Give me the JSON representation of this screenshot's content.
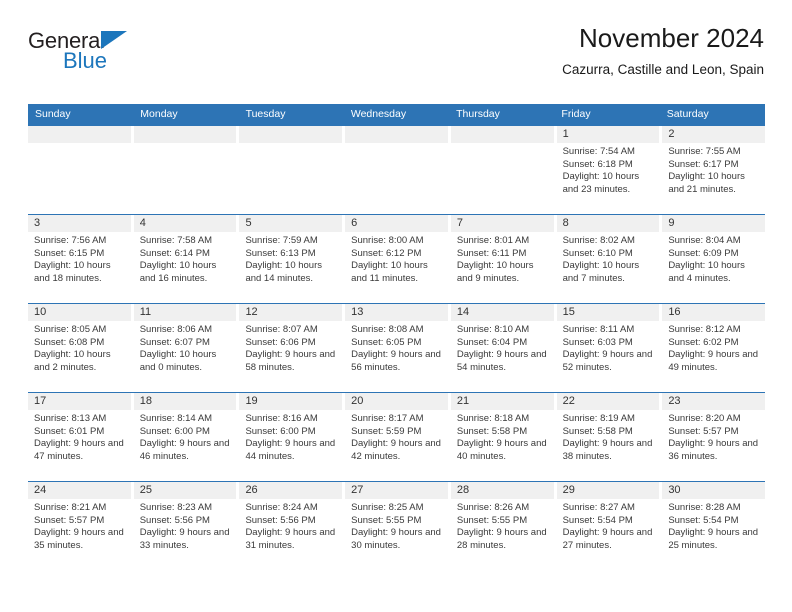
{
  "brand": {
    "name_top": "General",
    "name_bottom": "Blue",
    "accent_color": "#1c76bc"
  },
  "header": {
    "title": "November 2024",
    "subtitle": "Cazurra, Castille and Leon, Spain"
  },
  "calendar": {
    "header_color": "#2d74b5",
    "day_strip_color": "#f0f0f0",
    "weekdays": [
      "Sunday",
      "Monday",
      "Tuesday",
      "Wednesday",
      "Thursday",
      "Friday",
      "Saturday"
    ],
    "weeks": [
      [
        {
          "day": "",
          "blank": true
        },
        {
          "day": "",
          "blank": true
        },
        {
          "day": "",
          "blank": true
        },
        {
          "day": "",
          "blank": true
        },
        {
          "day": "",
          "blank": true
        },
        {
          "day": "1",
          "sunrise": "Sunrise: 7:54 AM",
          "sunset": "Sunset: 6:18 PM",
          "daylight": "Daylight: 10 hours and 23 minutes."
        },
        {
          "day": "2",
          "sunrise": "Sunrise: 7:55 AM",
          "sunset": "Sunset: 6:17 PM",
          "daylight": "Daylight: 10 hours and 21 minutes."
        }
      ],
      [
        {
          "day": "3",
          "sunrise": "Sunrise: 7:56 AM",
          "sunset": "Sunset: 6:15 PM",
          "daylight": "Daylight: 10 hours and 18 minutes."
        },
        {
          "day": "4",
          "sunrise": "Sunrise: 7:58 AM",
          "sunset": "Sunset: 6:14 PM",
          "daylight": "Daylight: 10 hours and 16 minutes."
        },
        {
          "day": "5",
          "sunrise": "Sunrise: 7:59 AM",
          "sunset": "Sunset: 6:13 PM",
          "daylight": "Daylight: 10 hours and 14 minutes."
        },
        {
          "day": "6",
          "sunrise": "Sunrise: 8:00 AM",
          "sunset": "Sunset: 6:12 PM",
          "daylight": "Daylight: 10 hours and 11 minutes."
        },
        {
          "day": "7",
          "sunrise": "Sunrise: 8:01 AM",
          "sunset": "Sunset: 6:11 PM",
          "daylight": "Daylight: 10 hours and 9 minutes."
        },
        {
          "day": "8",
          "sunrise": "Sunrise: 8:02 AM",
          "sunset": "Sunset: 6:10 PM",
          "daylight": "Daylight: 10 hours and 7 minutes."
        },
        {
          "day": "9",
          "sunrise": "Sunrise: 8:04 AM",
          "sunset": "Sunset: 6:09 PM",
          "daylight": "Daylight: 10 hours and 4 minutes."
        }
      ],
      [
        {
          "day": "10",
          "sunrise": "Sunrise: 8:05 AM",
          "sunset": "Sunset: 6:08 PM",
          "daylight": "Daylight: 10 hours and 2 minutes."
        },
        {
          "day": "11",
          "sunrise": "Sunrise: 8:06 AM",
          "sunset": "Sunset: 6:07 PM",
          "daylight": "Daylight: 10 hours and 0 minutes."
        },
        {
          "day": "12",
          "sunrise": "Sunrise: 8:07 AM",
          "sunset": "Sunset: 6:06 PM",
          "daylight": "Daylight: 9 hours and 58 minutes."
        },
        {
          "day": "13",
          "sunrise": "Sunrise: 8:08 AM",
          "sunset": "Sunset: 6:05 PM",
          "daylight": "Daylight: 9 hours and 56 minutes."
        },
        {
          "day": "14",
          "sunrise": "Sunrise: 8:10 AM",
          "sunset": "Sunset: 6:04 PM",
          "daylight": "Daylight: 9 hours and 54 minutes."
        },
        {
          "day": "15",
          "sunrise": "Sunrise: 8:11 AM",
          "sunset": "Sunset: 6:03 PM",
          "daylight": "Daylight: 9 hours and 52 minutes."
        },
        {
          "day": "16",
          "sunrise": "Sunrise: 8:12 AM",
          "sunset": "Sunset: 6:02 PM",
          "daylight": "Daylight: 9 hours and 49 minutes."
        }
      ],
      [
        {
          "day": "17",
          "sunrise": "Sunrise: 8:13 AM",
          "sunset": "Sunset: 6:01 PM",
          "daylight": "Daylight: 9 hours and 47 minutes."
        },
        {
          "day": "18",
          "sunrise": "Sunrise: 8:14 AM",
          "sunset": "Sunset: 6:00 PM",
          "daylight": "Daylight: 9 hours and 46 minutes."
        },
        {
          "day": "19",
          "sunrise": "Sunrise: 8:16 AM",
          "sunset": "Sunset: 6:00 PM",
          "daylight": "Daylight: 9 hours and 44 minutes."
        },
        {
          "day": "20",
          "sunrise": "Sunrise: 8:17 AM",
          "sunset": "Sunset: 5:59 PM",
          "daylight": "Daylight: 9 hours and 42 minutes."
        },
        {
          "day": "21",
          "sunrise": "Sunrise: 8:18 AM",
          "sunset": "Sunset: 5:58 PM",
          "daylight": "Daylight: 9 hours and 40 minutes."
        },
        {
          "day": "22",
          "sunrise": "Sunrise: 8:19 AM",
          "sunset": "Sunset: 5:58 PM",
          "daylight": "Daylight: 9 hours and 38 minutes."
        },
        {
          "day": "23",
          "sunrise": "Sunrise: 8:20 AM",
          "sunset": "Sunset: 5:57 PM",
          "daylight": "Daylight: 9 hours and 36 minutes."
        }
      ],
      [
        {
          "day": "24",
          "sunrise": "Sunrise: 8:21 AM",
          "sunset": "Sunset: 5:57 PM",
          "daylight": "Daylight: 9 hours and 35 minutes."
        },
        {
          "day": "25",
          "sunrise": "Sunrise: 8:23 AM",
          "sunset": "Sunset: 5:56 PM",
          "daylight": "Daylight: 9 hours and 33 minutes."
        },
        {
          "day": "26",
          "sunrise": "Sunrise: 8:24 AM",
          "sunset": "Sunset: 5:56 PM",
          "daylight": "Daylight: 9 hours and 31 minutes."
        },
        {
          "day": "27",
          "sunrise": "Sunrise: 8:25 AM",
          "sunset": "Sunset: 5:55 PM",
          "daylight": "Daylight: 9 hours and 30 minutes."
        },
        {
          "day": "28",
          "sunrise": "Sunrise: 8:26 AM",
          "sunset": "Sunset: 5:55 PM",
          "daylight": "Daylight: 9 hours and 28 minutes."
        },
        {
          "day": "29",
          "sunrise": "Sunrise: 8:27 AM",
          "sunset": "Sunset: 5:54 PM",
          "daylight": "Daylight: 9 hours and 27 minutes."
        },
        {
          "day": "30",
          "sunrise": "Sunrise: 8:28 AM",
          "sunset": "Sunset: 5:54 PM",
          "daylight": "Daylight: 9 hours and 25 minutes."
        }
      ]
    ]
  }
}
